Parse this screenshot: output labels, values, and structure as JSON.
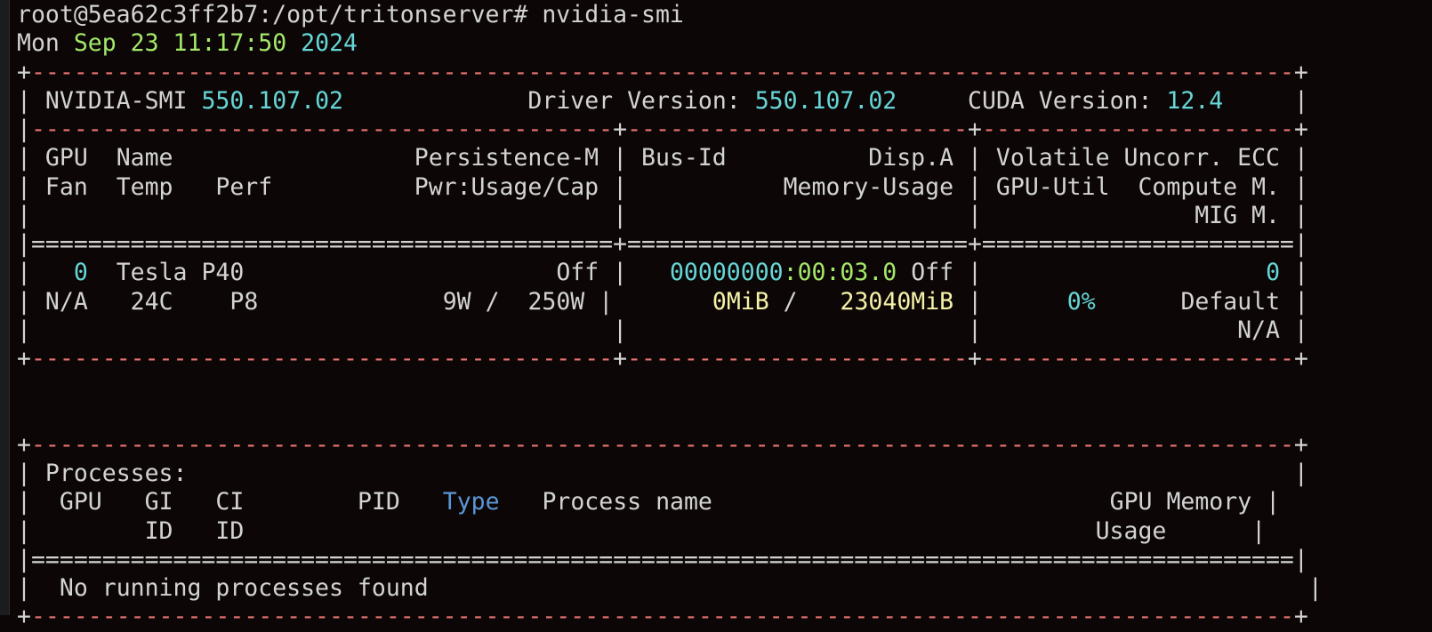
{
  "terminal": {
    "prompt": "root@5ea62c3ff2b7:/opt/tritonserver#",
    "command": "nvidia-smi"
  },
  "timestamp": {
    "day": "Mon",
    "date": "Sep 23",
    "time": "11:17:50",
    "year": "2024"
  },
  "header": {
    "smi_label": "NVIDIA-SMI",
    "smi_version": "550.107.02",
    "driver_label": "Driver Version:",
    "driver_version": "550.107.02",
    "cuda_label": "CUDA Version:",
    "cuda_version": "12.4"
  },
  "gpu_columns": {
    "r1c1": "GPU  Name                 Persistence-M",
    "r1c2": "Bus-Id          Disp.A",
    "r1c3": "Volatile Uncorr. ECC",
    "r2c1": "Fan  Temp   Perf          Pwr:Usage/Cap",
    "r2c2": "Memory-Usage",
    "r2c3": "GPU-Util  Compute M.",
    "r3c3": "MIG M."
  },
  "gpu": {
    "index": "0",
    "name": "Tesla P40",
    "persistence": "Off",
    "bus_id_prefix": "00000000",
    "bus_id_suffix": ":00:03.0",
    "disp": "Off",
    "ecc": "0",
    "fan": "N/A",
    "temp": "24C",
    "perf": "P8",
    "power": "9W /  250W",
    "memory_used": "0MiB",
    "memory_sep": "/",
    "memory_total": "23040MiB",
    "util": "0%",
    "compute_mode": "Default",
    "mig_mode": "N/A"
  },
  "processes": {
    "title": "Processes:",
    "col_gpu": "GPU",
    "col_gi": "GI",
    "col_ci": "CI",
    "col_pid": "PID",
    "col_type": "Type",
    "col_name": "Process name",
    "col_mem": "GPU Memory",
    "col_gi2": "ID",
    "col_ci2": "ID",
    "col_mem2": "Usage",
    "empty_message": "No running processes found"
  }
}
